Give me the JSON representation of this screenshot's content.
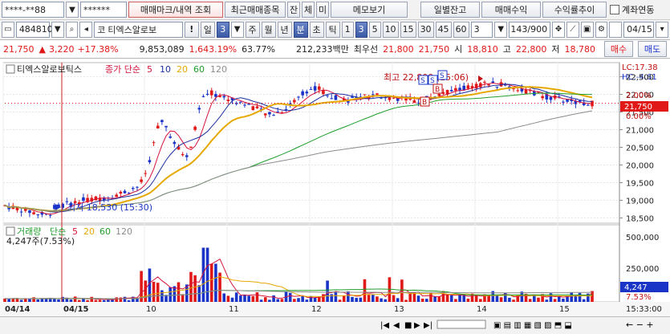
{
  "toolbar1": {
    "account": "****-**88",
    "password": "******",
    "btn_mark": "매매마크/내역 조회",
    "btn_recent": "최근매매종목",
    "btn_jan": "잔",
    "btn_che": "체",
    "btn_mi": "미",
    "btn_memo": "메모보기",
    "btn_daily": "일별잔고",
    "btn_profit": "매매수익",
    "btn_return": "수익률추이",
    "chk_link": "계좌연동"
  },
  "toolbar2": {
    "code": "484810",
    "market": "코",
    "stock_name": "티엑스알로보",
    "excl": "!",
    "period_label": "일",
    "period_num": "3",
    "tabs": [
      "주",
      "월",
      "년",
      "분",
      "초",
      "틱"
    ],
    "intervals": [
      "1",
      "3",
      "5",
      "10",
      "15",
      "30",
      "45",
      "60"
    ],
    "interval_selected": "3",
    "custom_num": "3",
    "count": "143",
    "count_total": "/900",
    "date": "04/15"
  },
  "quote": {
    "price": "21,750",
    "change_arrow": "▲",
    "change": "3,220",
    "change_pct": "+17.38%",
    "volume": "9,853,089",
    "vol_ratio": "1,643.19%",
    "turnover": "63.77%",
    "amount": "212,233백만",
    "order_label": "최우선",
    "best_ask": "21,800",
    "best_bid": "21,750",
    "open_label": "시",
    "open": "18,810",
    "high_label": "고",
    "high": "22,800",
    "low_label": "저",
    "low": "18,780",
    "buy_label": "매수",
    "sell_label": "매도"
  },
  "price_pane": {
    "legend_name": "티엑스알로보틱스",
    "legend_type": "종가 단순",
    "ma_periods": [
      "5",
      "10",
      "20",
      "60",
      "120"
    ],
    "high_note": "최고 22,800 (15:06)",
    "low_note": "최저 18,530 (15:30)",
    "lc": "LC:17.38",
    "hc": "HC:-4.61",
    "current_price_label": "21,750",
    "current_pct_label": "0.00%",
    "ref_pct_label": "2.00%",
    "y_ticks": [
      "22,500",
      "22,000",
      "21,500",
      "21,000",
      "20,500",
      "20,000",
      "19,500",
      "19,000",
      "18,500"
    ]
  },
  "volume_pane": {
    "legend_name": "거래량",
    "legend_type": "단순",
    "ma_periods": [
      "5",
      "20",
      "60",
      "120"
    ],
    "last_label": "4,247주(7.53%)",
    "current_volume": "4,247",
    "current_pct": "7.53%",
    "y_ticks": [
      "500,000",
      "250,000"
    ]
  },
  "x_axis": {
    "labels": [
      "04/14",
      "04/15",
      "10",
      "11",
      "12",
      "13",
      "14",
      "15"
    ],
    "time": "15:33:00"
  },
  "colors": {
    "up": "#e01818",
    "down": "#1a34c8",
    "ma5": "#d4143c",
    "ma10": "#1a2fa0",
    "ma20": "#e6a800",
    "ma60": "#1f9e2c",
    "ma120": "#8c8c8c"
  },
  "chart_data": {
    "type": "candlestick",
    "price_range": [
      18350,
      22900
    ],
    "volume_range": [
      0,
      560000
    ],
    "high": 22800,
    "low": 18530,
    "close": 21750
  }
}
